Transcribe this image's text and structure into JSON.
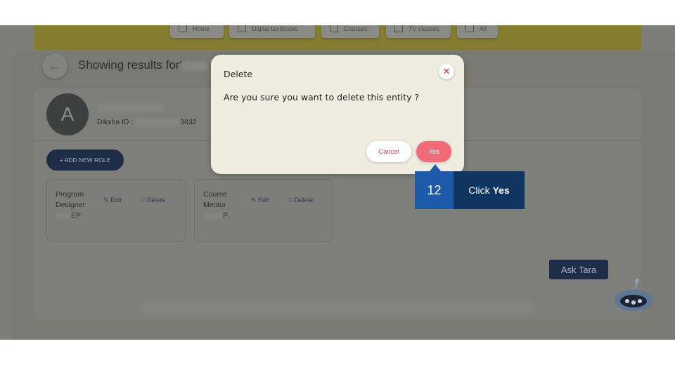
{
  "nav": {
    "tabs": [
      {
        "label": "Home",
        "icon": "home-icon"
      },
      {
        "label": "Digital textbooks",
        "icon": "book-icon"
      },
      {
        "label": "Courses",
        "icon": "courses-icon"
      },
      {
        "label": "TV classes",
        "icon": "tv-icon"
      },
      {
        "label": "All",
        "icon": "grid-icon"
      }
    ]
  },
  "page": {
    "results_title": "Showing results for'",
    "back_icon": "arrow-left-icon"
  },
  "user": {
    "avatar_letter": "A",
    "diksha_label": "Diksha ID :",
    "diksha_suffix": "3832"
  },
  "roles": {
    "add_label": "+ ADD NEW ROLE",
    "items": [
      {
        "title_line1": "Program",
        "title_line2": "Designer",
        "title_line3": "EP",
        "edit": "Edit",
        "delete": "Delete"
      },
      {
        "title_line1": "Course",
        "title_line2": "Mentor",
        "title_line3": "P",
        "edit": "Edit",
        "delete": "Delete"
      }
    ]
  },
  "modal": {
    "title": "Delete",
    "message": "Are you sure you want to delete this entity ?",
    "close_symbol": "✕",
    "cancel_label": "Cancel",
    "yes_label": "Yes"
  },
  "callout": {
    "step": "12",
    "prefix": "Click",
    "target": "Yes"
  },
  "assistant": {
    "label": "Ask Tara"
  },
  "colors": {
    "accent_yes": "#f06a7a",
    "callout_step": "#1f5aa8",
    "callout_body": "#0f3661",
    "primary_dark": "#1d2d45"
  }
}
